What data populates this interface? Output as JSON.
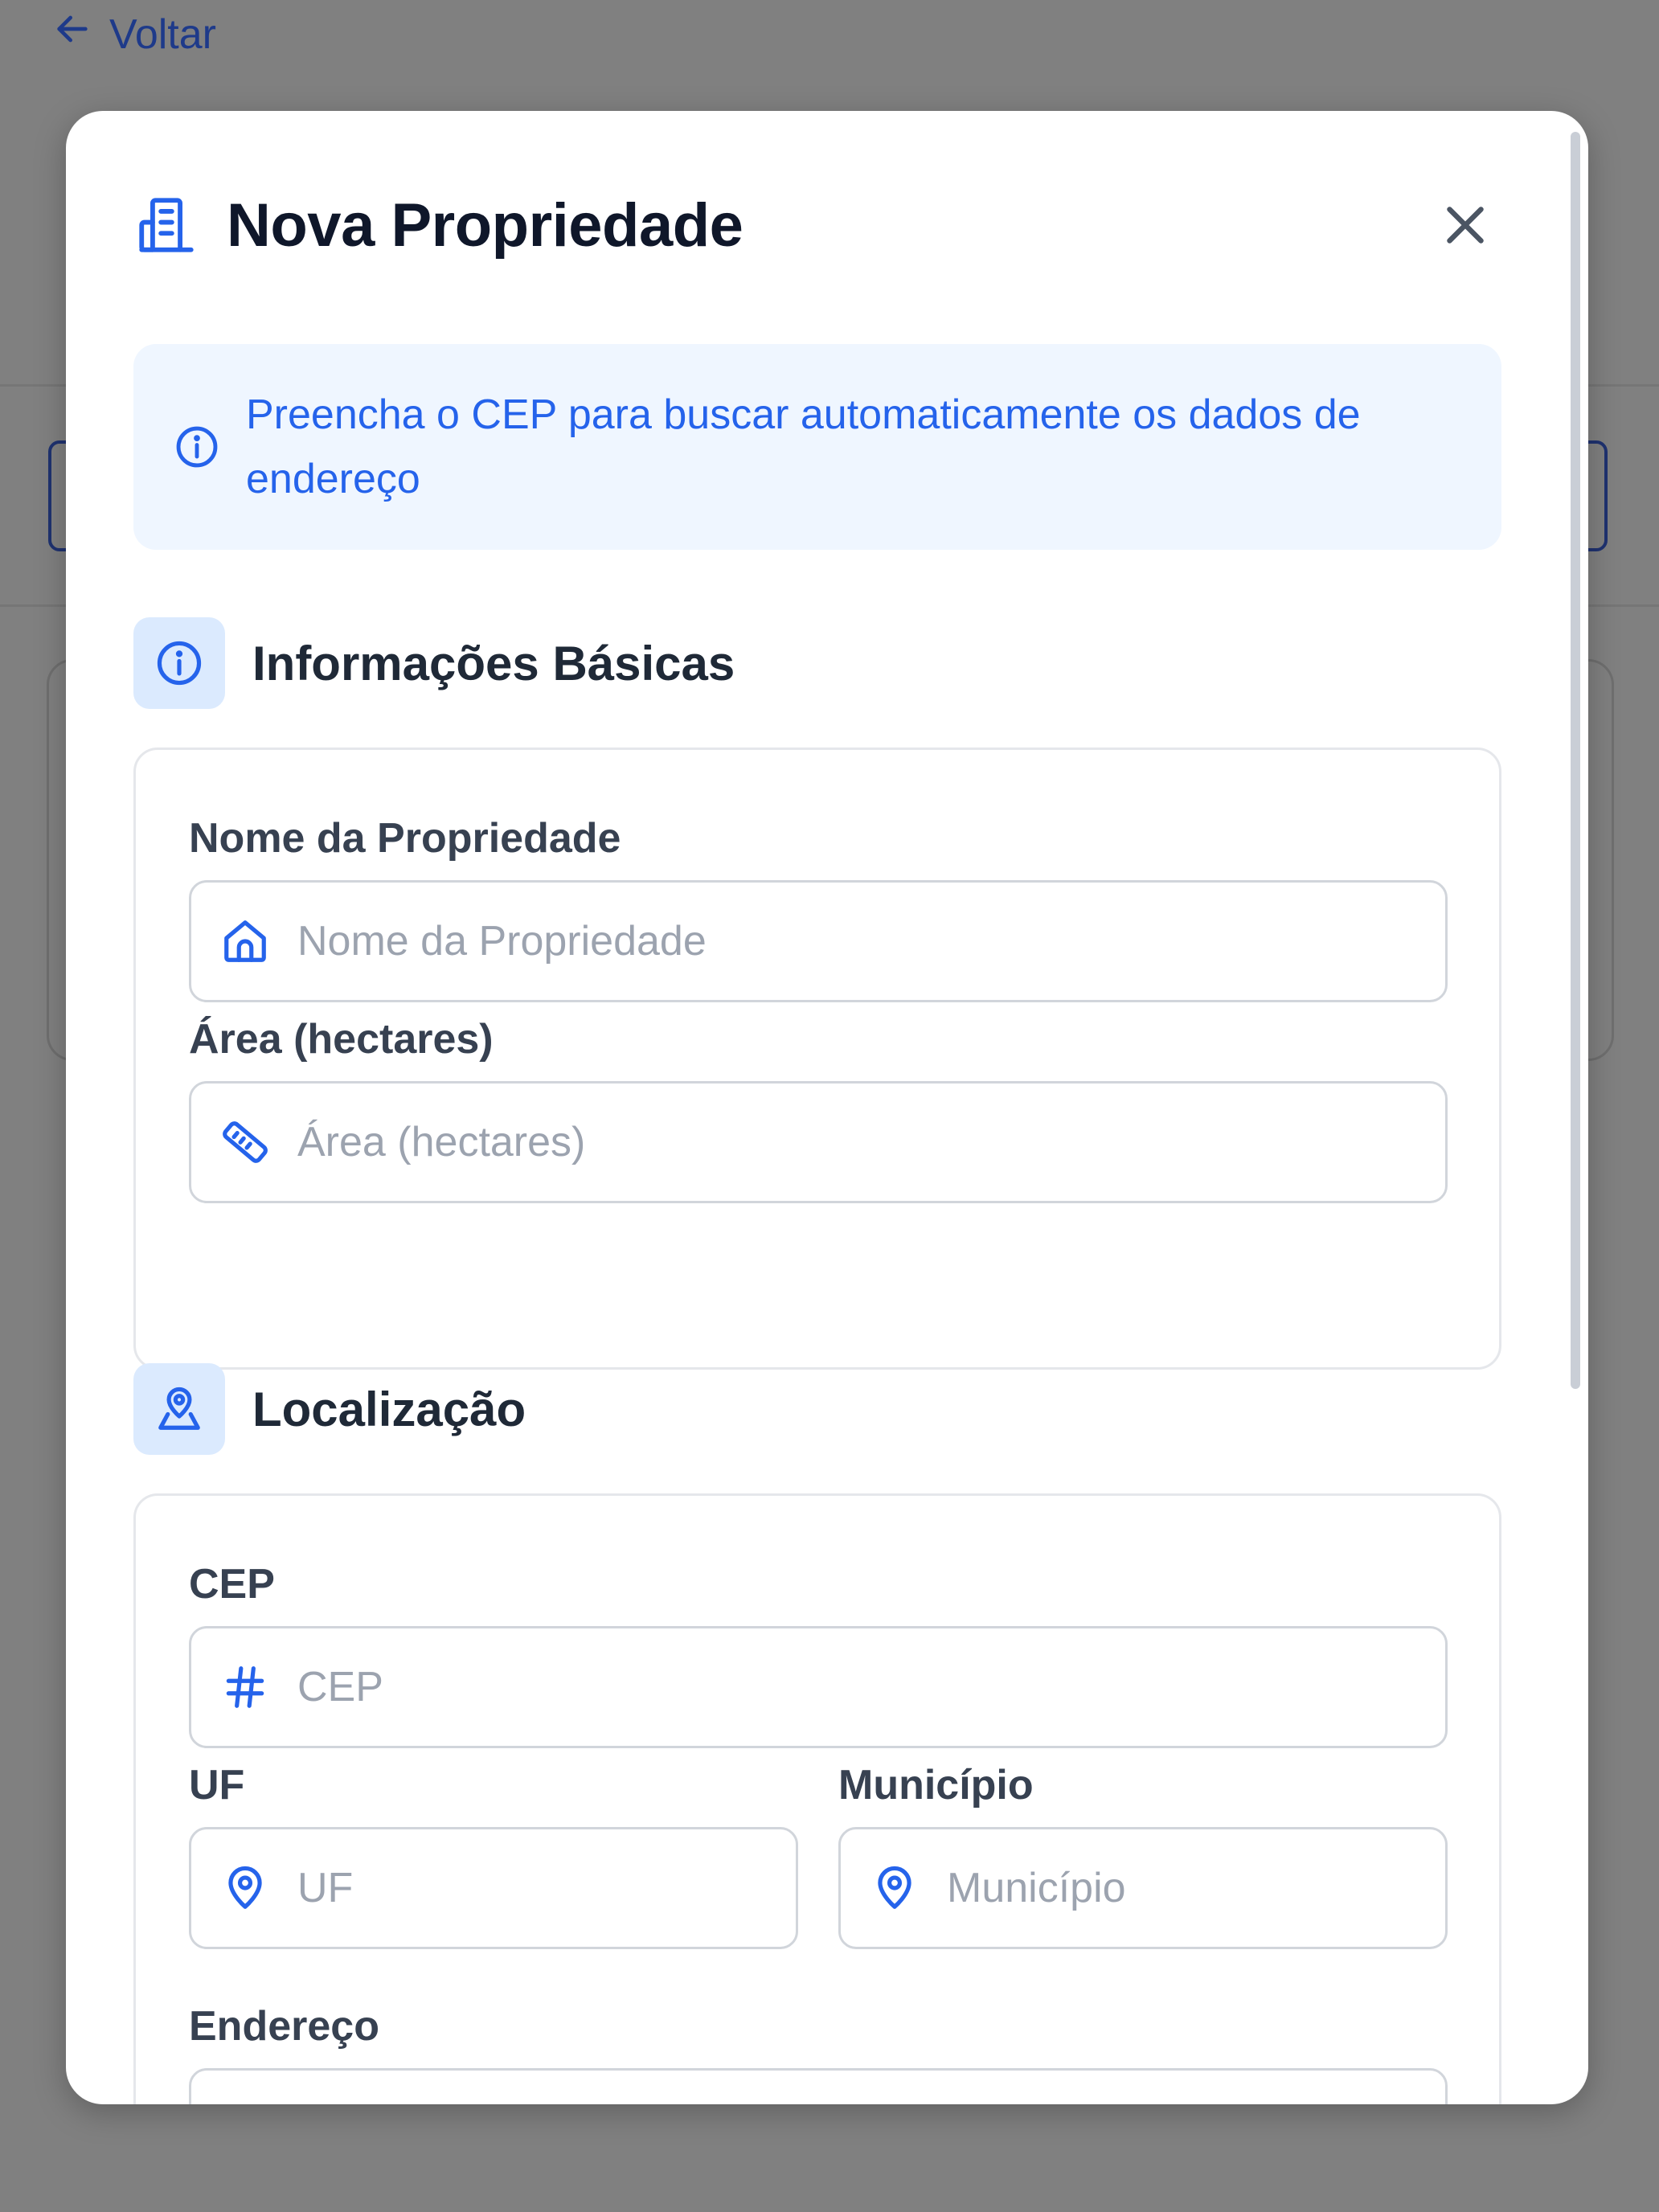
{
  "background": {
    "back_label": "Voltar"
  },
  "modal": {
    "title": "Nova Propriedade",
    "info_message": "Preencha o CEP para buscar automaticamente os dados de endereço",
    "sections": {
      "basic": {
        "title": "Informações Básicas",
        "fields": {
          "name": {
            "label": "Nome da Propriedade",
            "placeholder": "Nome da Propriedade",
            "value": ""
          },
          "area": {
            "label": "Área (hectares)",
            "placeholder": "Área (hectares)",
            "value": ""
          }
        }
      },
      "location": {
        "title": "Localização",
        "fields": {
          "cep": {
            "label": "CEP",
            "placeholder": "CEP",
            "value": ""
          },
          "uf": {
            "label": "UF",
            "placeholder": "UF",
            "value": ""
          },
          "municipio": {
            "label": "Município",
            "placeholder": "Município",
            "value": ""
          },
          "endereco": {
            "label": "Endereço",
            "placeholder": "",
            "value": ""
          }
        }
      }
    }
  },
  "colors": {
    "accent": "#2563eb",
    "overlay": "#808080",
    "info_bg": "#eff6ff",
    "icon_chip_bg": "#dbeafe"
  },
  "icons": {
    "back": "arrow-left-icon",
    "title": "building-icon",
    "close": "close-icon",
    "info": "info-circle-icon",
    "location": "map-pin-person-icon",
    "name_field": "home-icon",
    "area_field": "ruler-icon",
    "cep_field": "hash-icon",
    "uf_field": "location-pin-icon",
    "municipio_field": "location-pin-icon"
  }
}
